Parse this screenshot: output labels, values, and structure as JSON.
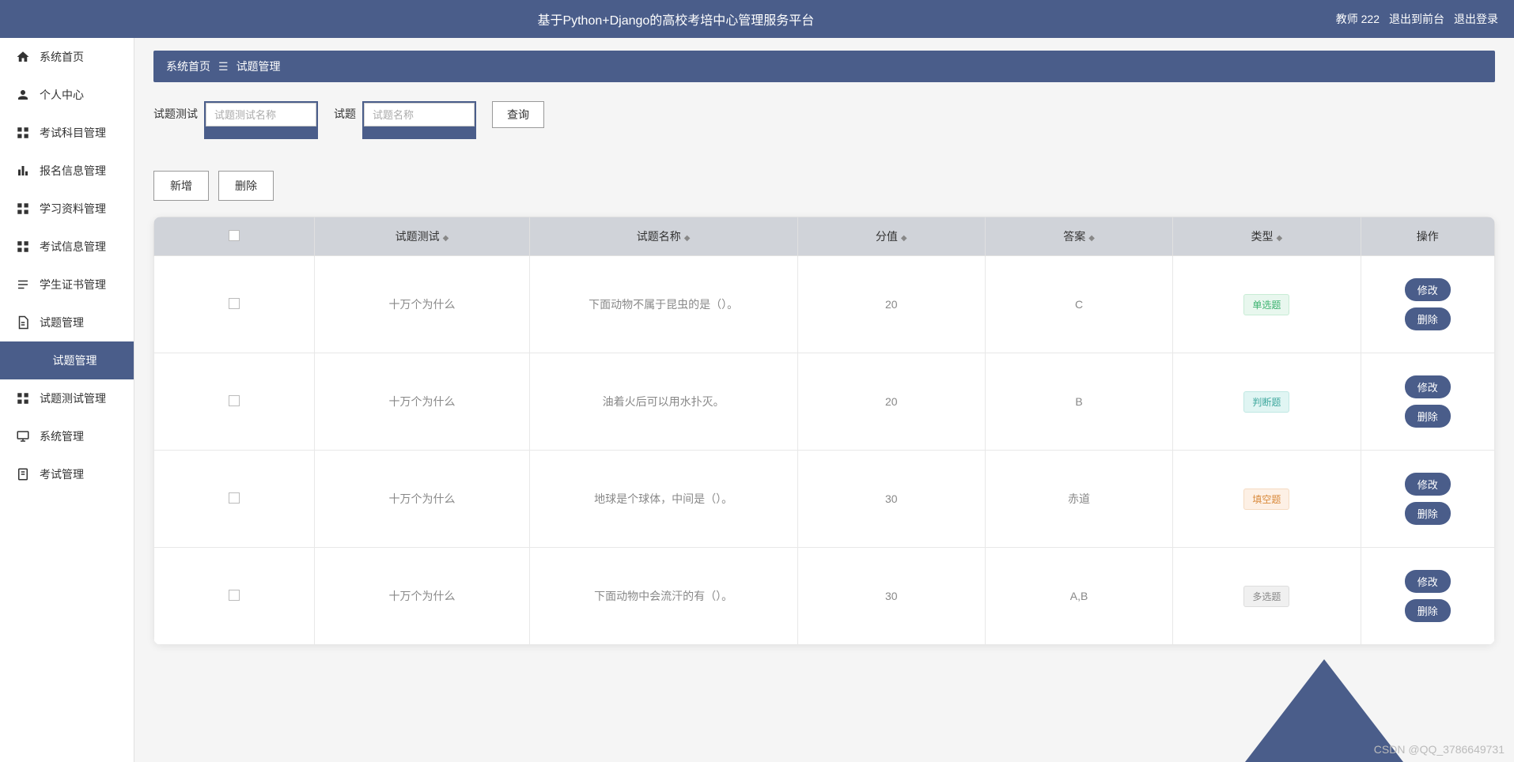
{
  "header": {
    "title": "基于Python+Django的高校考培中心管理服务平台",
    "user_label": "教师 222",
    "logout_front": "退出到前台",
    "logout": "退出登录"
  },
  "sidebar": {
    "items": [
      {
        "icon": "home",
        "label": "系统首页"
      },
      {
        "icon": "person",
        "label": "个人中心"
      },
      {
        "icon": "grid",
        "label": "考试科目管理"
      },
      {
        "icon": "bars",
        "label": "报名信息管理"
      },
      {
        "icon": "grid",
        "label": "学习资料管理"
      },
      {
        "icon": "grid",
        "label": "考试信息管理"
      },
      {
        "icon": "cert",
        "label": "学生证书管理"
      },
      {
        "icon": "doc",
        "label": "试题管理"
      },
      {
        "icon": "",
        "label": "试题管理",
        "active": true,
        "sub": true
      },
      {
        "icon": "grid",
        "label": "试题测试管理"
      },
      {
        "icon": "sys",
        "label": "系统管理"
      },
      {
        "icon": "exam",
        "label": "考试管理"
      }
    ]
  },
  "breadcrumb": {
    "home": "系统首页",
    "current": "试题管理"
  },
  "filters": {
    "test_label": "试题测试",
    "test_placeholder": "试题测试名称",
    "name_label": "试题",
    "name_placeholder": "试题名称",
    "search_btn": "查询"
  },
  "actions": {
    "add": "新增",
    "delete": "删除"
  },
  "table": {
    "headers": {
      "test": "试题测试",
      "name": "试题名称",
      "score": "分值",
      "answer": "答案",
      "type": "类型",
      "op": "操作"
    },
    "op_edit": "修改",
    "op_delete": "删除",
    "rows": [
      {
        "test": "十万个为什么",
        "name": "下面动物不属于昆虫的是（）。",
        "score": "20",
        "answer": "C",
        "type": "单选题",
        "type_cls": "tag-green"
      },
      {
        "test": "十万个为什么",
        "name": "油着火后可以用水扑灭。",
        "score": "20",
        "answer": "B",
        "type": "判断题",
        "type_cls": "tag-teal"
      },
      {
        "test": "十万个为什么",
        "name": "地球是个球体，中间是（）。",
        "score": "30",
        "answer": "赤道",
        "type": "填空题",
        "type_cls": "tag-orange"
      },
      {
        "test": "十万个为什么",
        "name": "下面动物中会流汗的有（）。",
        "score": "30",
        "answer": "A,B",
        "type": "多选题",
        "type_cls": "tag-gray"
      }
    ]
  },
  "watermark": "CSDN @QQ_3786649731"
}
